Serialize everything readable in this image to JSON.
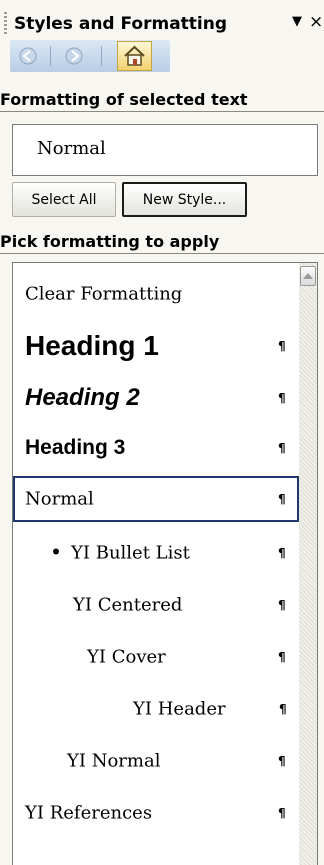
{
  "pane": {
    "title": "Styles and Formatting",
    "menu_glyph": "▼",
    "close_glyph": "×"
  },
  "nav": {
    "back_icon": "back-arrow-icon",
    "forward_icon": "forward-arrow-icon",
    "home_icon": "home-icon"
  },
  "selected_section": {
    "label": "Formatting of selected text",
    "current_style": "Normal"
  },
  "buttons": {
    "select_all": "Select All",
    "new_style": "New Style..."
  },
  "pick_section": {
    "label": "Pick formatting to apply"
  },
  "styles": [
    {
      "label": "Clear Formatting",
      "mark": ""
    },
    {
      "label": "Heading 1",
      "mark": "¶"
    },
    {
      "label": "Heading 2",
      "mark": "¶"
    },
    {
      "label": "Heading 3",
      "mark": "¶"
    },
    {
      "label": "Normal",
      "mark": "¶"
    },
    {
      "label": "YI Bullet List",
      "mark": "¶"
    },
    {
      "label": "YI Centered",
      "mark": "¶"
    },
    {
      "label": "YI Cover",
      "mark": "¶"
    },
    {
      "label": "YI Header",
      "mark": "¶"
    },
    {
      "label": "YI Normal",
      "mark": "¶"
    },
    {
      "label": "YI References",
      "mark": "¶"
    }
  ],
  "colors": {
    "pane_background": "#f7f6f0",
    "selection_border": "#1f3870",
    "nav_gradient": "#dbe8f6"
  }
}
